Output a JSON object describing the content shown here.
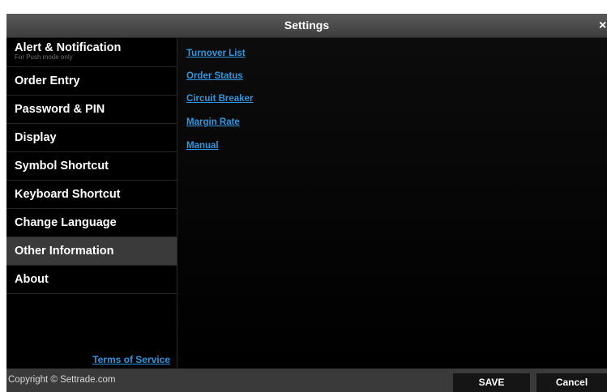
{
  "window": {
    "title": "Settings",
    "close_glyph": "×"
  },
  "sidebar": {
    "items": [
      {
        "label": "Alert & Notification",
        "sublabel": "For Push mode only"
      },
      {
        "label": "Order Entry"
      },
      {
        "label": "Password & PIN"
      },
      {
        "label": "Display"
      },
      {
        "label": "Symbol Shortcut"
      },
      {
        "label": "Keyboard Shortcut"
      },
      {
        "label": "Change Language"
      },
      {
        "label": "Other Information",
        "selected": true
      },
      {
        "label": "About"
      }
    ],
    "terms_link": "Terms of Service"
  },
  "content": {
    "links": [
      {
        "label": "Turnover List"
      },
      {
        "label": "Order Status"
      },
      {
        "label": "Circuit Breaker"
      },
      {
        "label": "Margin Rate"
      },
      {
        "label": "Manual"
      }
    ]
  },
  "footer": {
    "copyright": "Copyright © Settrade.com",
    "save_label": "SAVE",
    "cancel_label": "Cancel"
  },
  "colors": {
    "link": "#2f97e0",
    "selected_item_bg": "#3a3a3a",
    "background": "#000000"
  },
  "icons": {
    "close": "close-icon"
  }
}
